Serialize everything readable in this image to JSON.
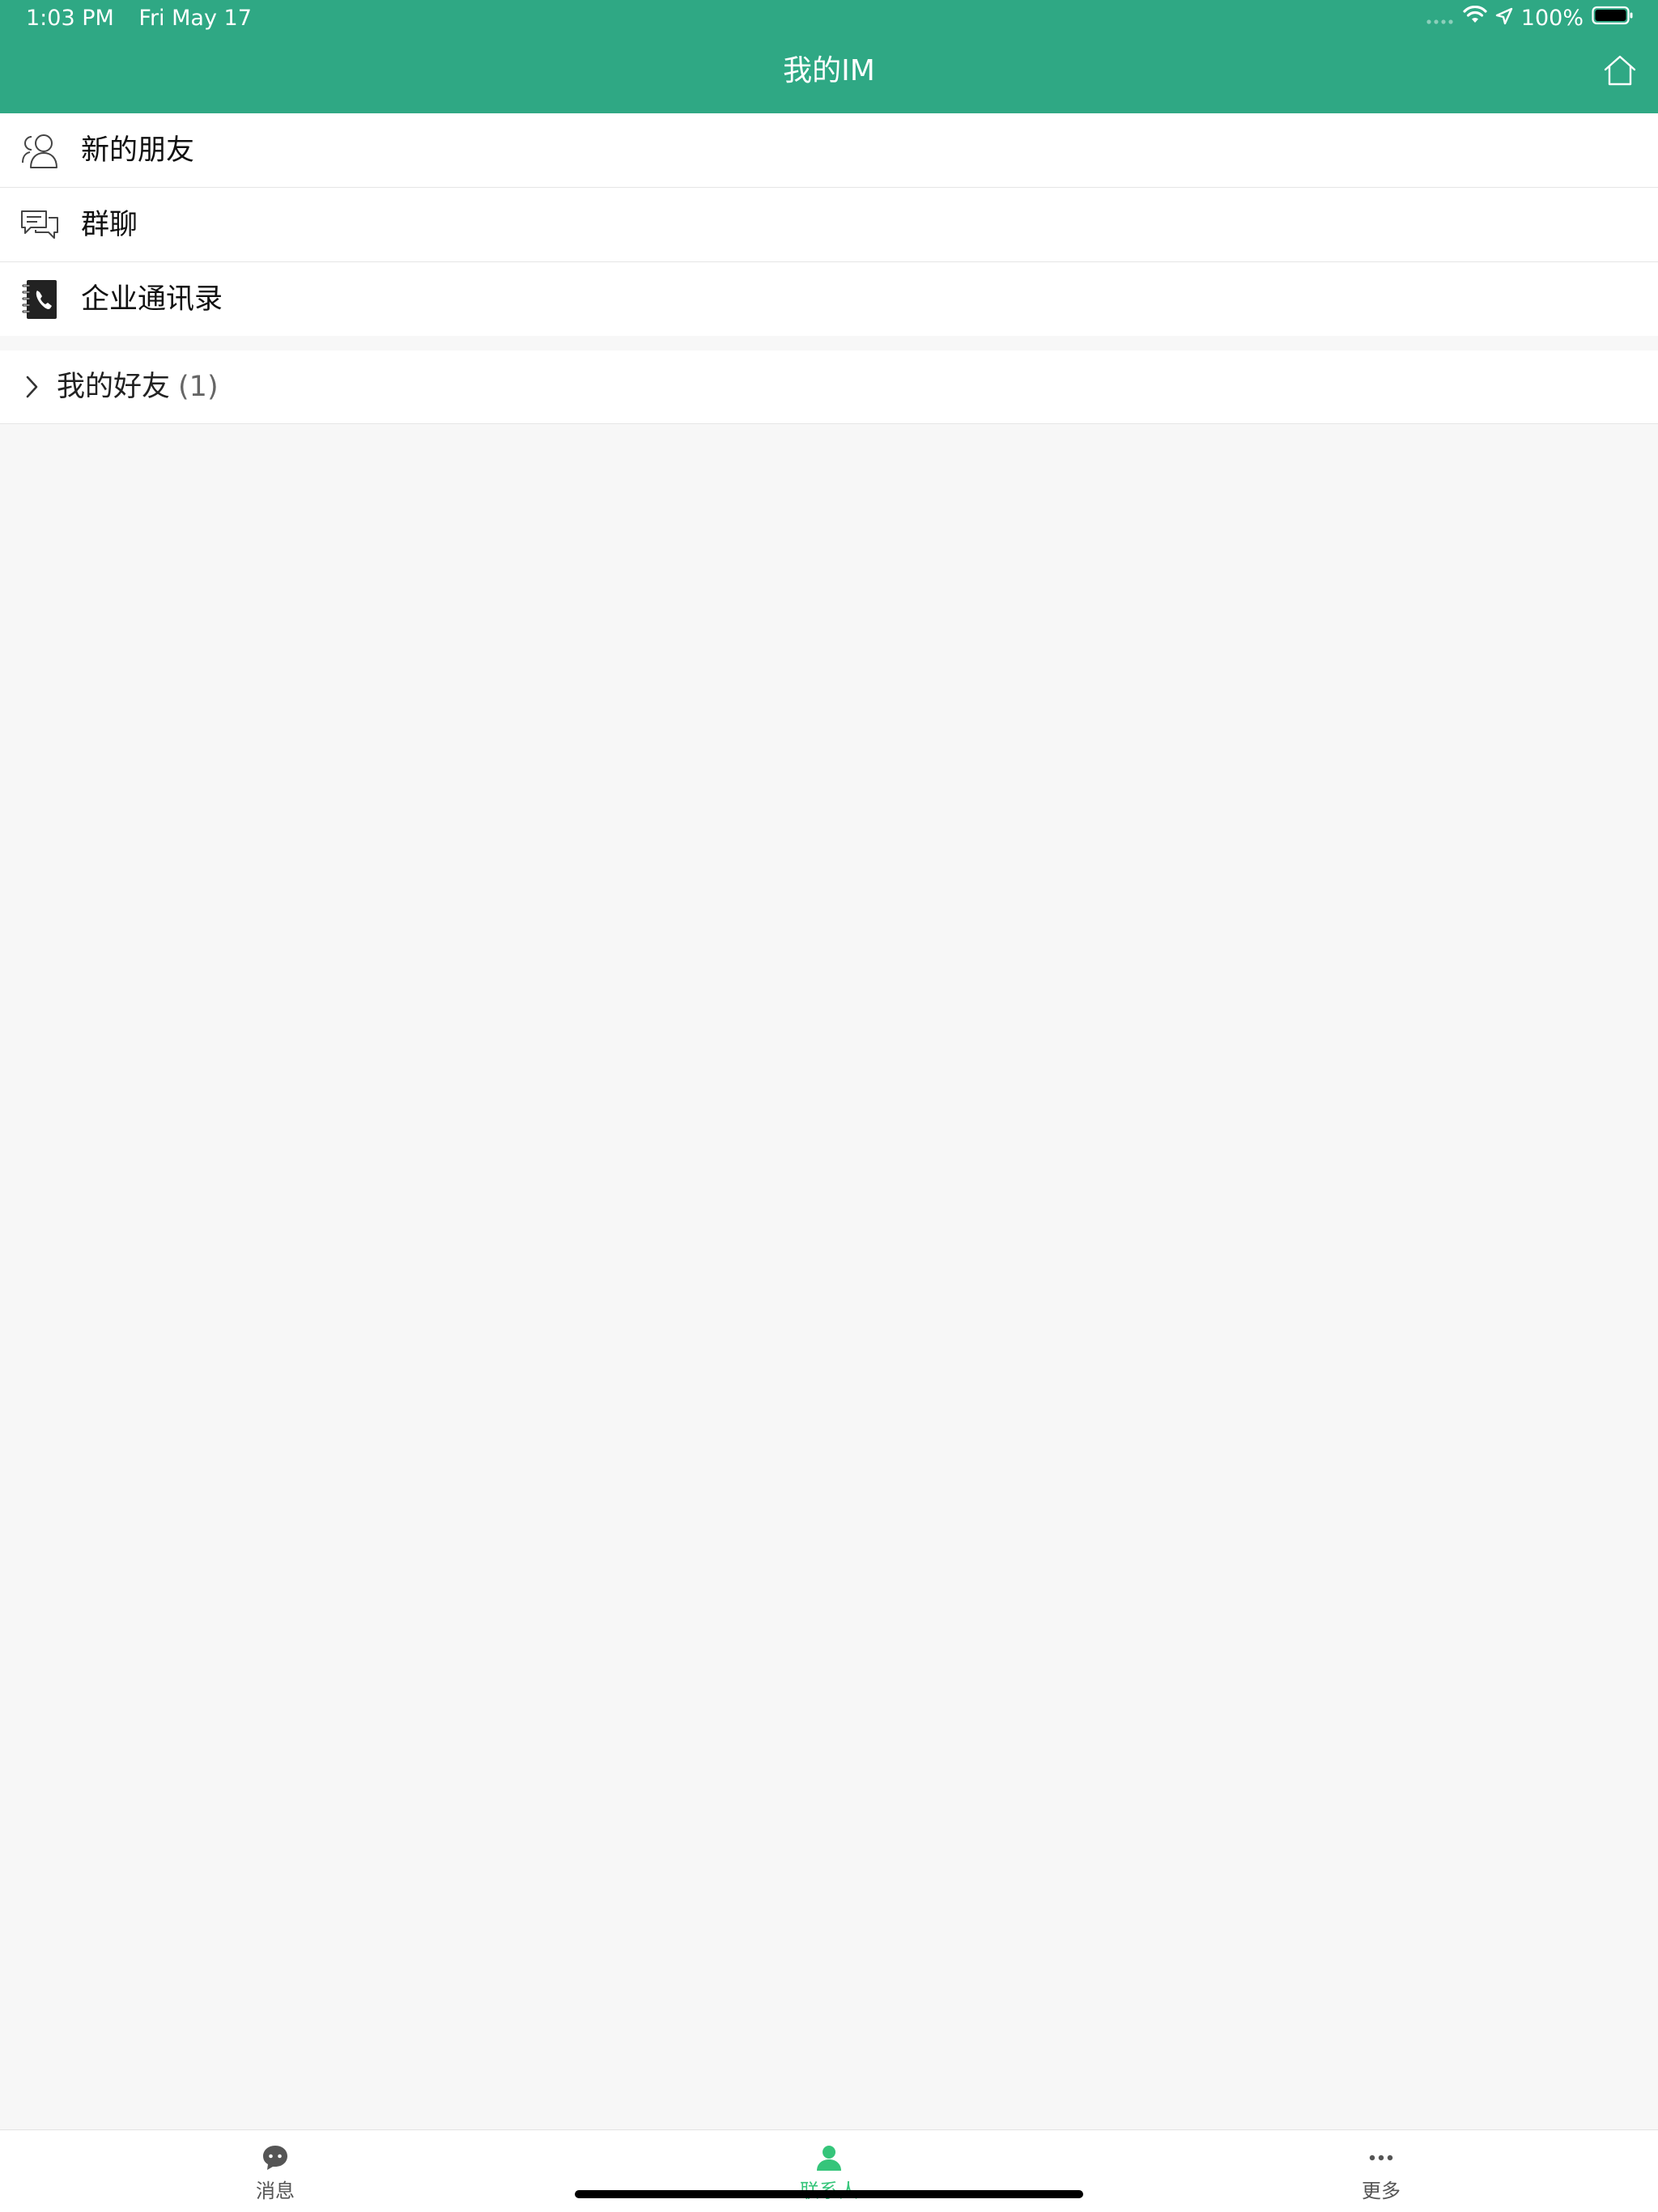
{
  "status_bar": {
    "time": "1:03 PM",
    "date": "Fri May 17",
    "battery": "100%"
  },
  "nav": {
    "title": "我的IM",
    "home_icon": "home-icon"
  },
  "menu": [
    {
      "label": "新的朋友",
      "icon": "new-friends-icon"
    },
    {
      "label": "群聊",
      "icon": "group-chat-icon"
    },
    {
      "label": "企业通讯录",
      "icon": "address-book-icon"
    }
  ],
  "friends_group": {
    "label": "我的好友",
    "count": "(1)"
  },
  "tabs": [
    {
      "label": "消息",
      "icon": "chat-bubble-icon",
      "active": false
    },
    {
      "label": "联系人",
      "icon": "person-icon",
      "active": true
    },
    {
      "label": "更多",
      "icon": "more-dots-icon",
      "active": false
    }
  ],
  "colors": {
    "header": "#2fa884",
    "active_tab": "#35c57a",
    "background": "#f7f7f7"
  }
}
